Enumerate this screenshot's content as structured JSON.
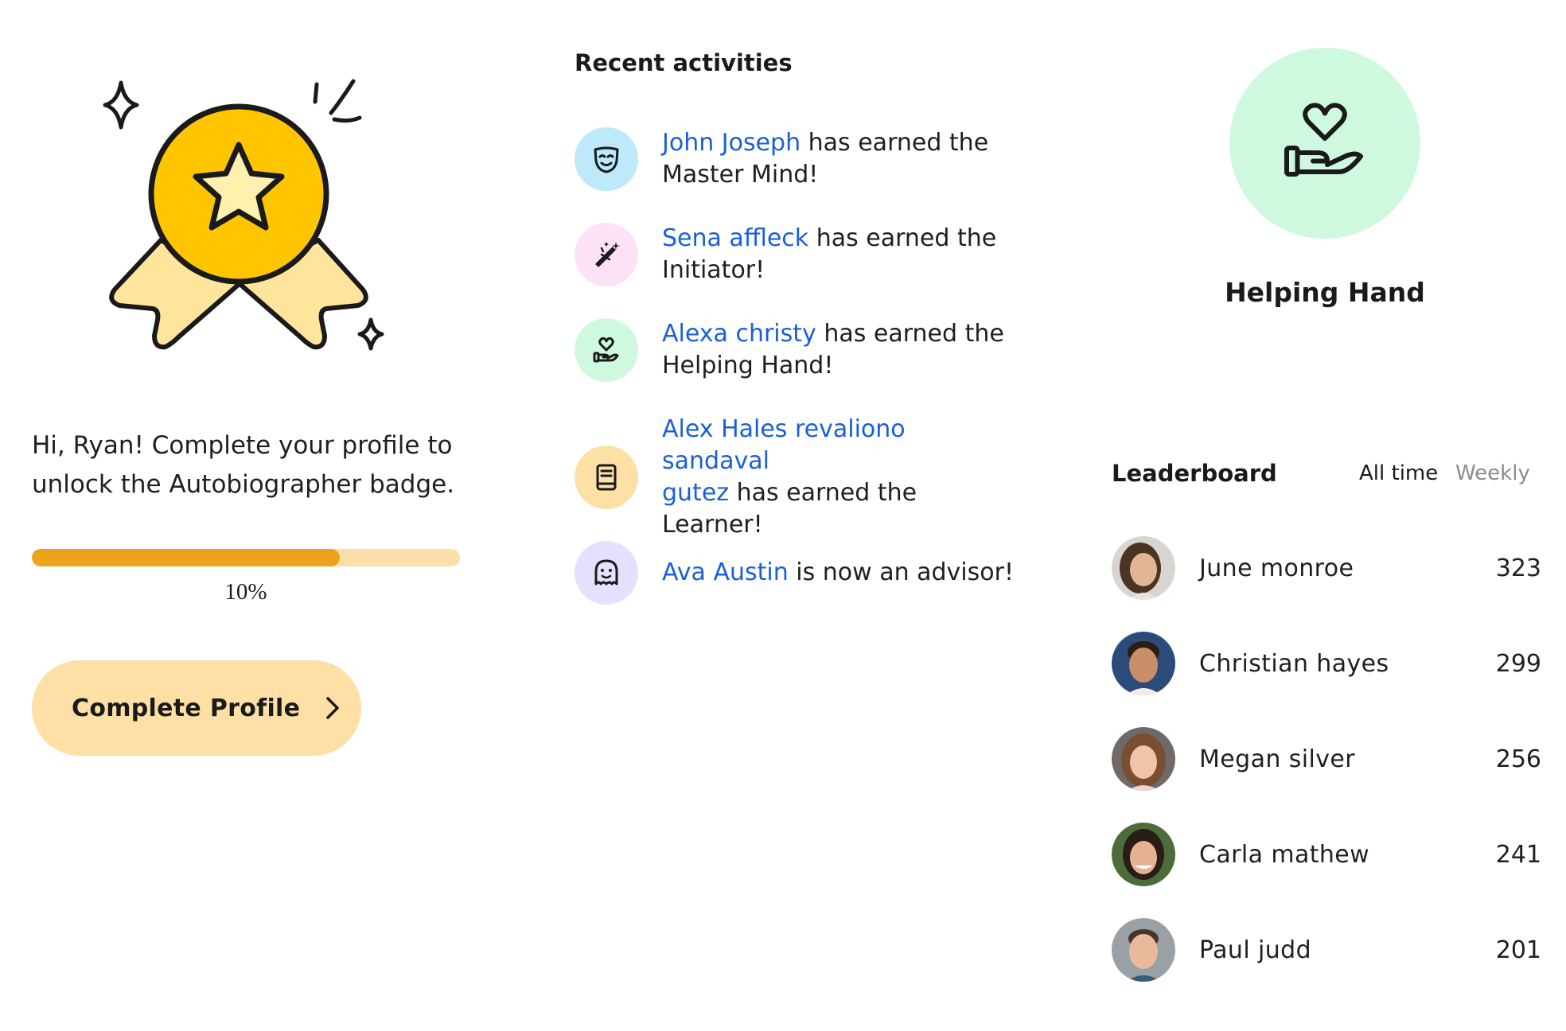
{
  "profile": {
    "welcome_line1": "Hi, Ryan! Complete your profile to",
    "welcome_line2": "unlock the Autobiographer badge.",
    "progress_fraction": 0.72,
    "progress_label": "10%",
    "complete_button_label": "Complete Profile"
  },
  "activities": {
    "title": "Recent activities",
    "items": [
      {
        "icon": "mask-icon",
        "name": "John Joseph",
        "rest": " has earned the",
        "line2": "Master Mind!",
        "color": "#bde9fb"
      },
      {
        "icon": "magic-wand-icon",
        "name": "Sena affleck",
        "rest": " has earned the",
        "line2": "Initiator!",
        "color": "#fde1f7"
      },
      {
        "icon": "helping-hand-icon",
        "name": "Alexa christy",
        "rest": " has earned the",
        "line2": "Helping Hand!",
        "color": "#cef9de"
      },
      {
        "icon": "book-icon",
        "name_line1": "Alex Hales revaliono sandaval",
        "name_line2": "gutez",
        "rest": " has earned the",
        "line3": "Learner!",
        "color": "#fde0a6"
      },
      {
        "icon": "ghost-icon",
        "name": "Ava Austin",
        "rest": " is now an advisor!",
        "color": "#e5e0fe"
      }
    ]
  },
  "feature_badge": {
    "title": "Helping Hand",
    "icon": "helping-hand-icon",
    "color": "#cef9de"
  },
  "leaderboard": {
    "title": "Leaderboard",
    "tabs": [
      "All time",
      "Weekly"
    ],
    "active_tab": "All time",
    "rows": [
      {
        "name": "June monroe",
        "score": "323"
      },
      {
        "name": "Christian hayes",
        "score": "299"
      },
      {
        "name": "Megan silver",
        "score": "256"
      },
      {
        "name": "Carla mathew",
        "score": "241"
      },
      {
        "name": "Paul judd",
        "score": "201"
      }
    ]
  }
}
